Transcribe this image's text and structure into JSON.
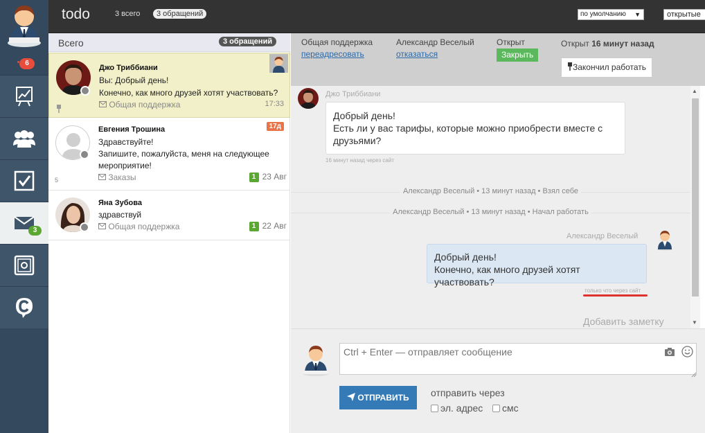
{
  "rail": {
    "notifications": "6",
    "items": [
      {
        "name": "reports",
        "icon": "chart-easel-icon"
      },
      {
        "name": "clients",
        "icon": "people-icon"
      },
      {
        "name": "tasks",
        "icon": "checkbox-icon"
      },
      {
        "name": "mail",
        "icon": "envelope-icon",
        "badge": "3"
      },
      {
        "name": "safe",
        "icon": "safe-icon"
      },
      {
        "name": "chat",
        "icon": "c-bubble-icon"
      }
    ]
  },
  "topbar": {
    "title": "todo",
    "count_all": "3 всего",
    "count_requests": "3 обращений",
    "sort": "по умолчанию",
    "filter": "открытые"
  },
  "list": {
    "header": "Всего",
    "header_count": "3 обращений",
    "conversations": [
      {
        "name": "Джо Триббиани",
        "line1": "Вы: Добрый день!",
        "line2": "Конечно, как много друзей хотят участвовать?",
        "channel": "Общая поддержка",
        "time": "17:33"
      },
      {
        "name": "Евгения Трошина",
        "line1": "Здравствуйте!",
        "line2": "Запишите, пожалуйста, меня на следующее",
        "line3": "мероприятие!",
        "channel": "Заказы",
        "overdue": "17д",
        "count": "1",
        "date": "23 Авг",
        "small_num": "5"
      },
      {
        "name": "Яна Зубова",
        "line1": "здравствуй",
        "channel": "Общая поддержка",
        "count": "1",
        "date": "22 Авг"
      }
    ]
  },
  "detail": {
    "group": "Общая поддержка",
    "redirect": "переадресовать",
    "agent": "Александр Веселый",
    "refuse": "отказаться",
    "status": "Открыт",
    "close": "Закрыть",
    "opened_prefix": "Открыт",
    "opened_ago": "16 минут назад",
    "done": "Закончил работать"
  },
  "chat": {
    "incoming_author": "Джо Триббиани",
    "incoming_line1": "Добрый день!",
    "incoming_line2": "Есть ли у вас тарифы, которые можно приобрести вместе с",
    "incoming_line3": "друзьями?",
    "incoming_foot": "16 минут назад через сайт",
    "system1": "Александр Веселый • 13 минут назад • Взял себе",
    "system2": "Александр Веселый • 13 минут назад • Начал работать",
    "outgoing_author": "Александр Веселый",
    "outgoing_line1": "Добрый день!",
    "outgoing_line2": "Конечно, как много друзей хотят участвовать?",
    "outgoing_foot": "только что через сайт",
    "add_note": "Добавить заметку"
  },
  "composer": {
    "placeholder": "Ctrl + Enter — отправляет сообщение",
    "send": "ОТПРАВИТЬ",
    "send_via": "отправить через",
    "via_email": "эл. адрес",
    "via_sms": "смс"
  }
}
